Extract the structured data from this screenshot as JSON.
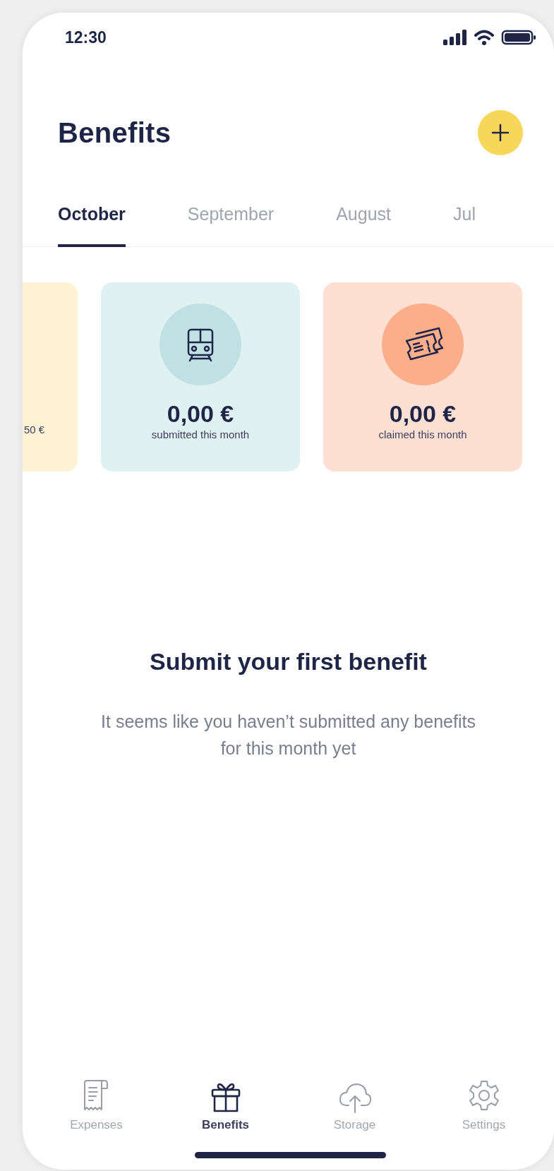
{
  "status_bar": {
    "time": "12:30"
  },
  "header": {
    "title": "Benefits"
  },
  "tabs": [
    {
      "label": "October",
      "selected": true
    },
    {
      "label": "September",
      "selected": false
    },
    {
      "label": "August",
      "selected": false
    },
    {
      "label": "Jul",
      "selected": false
    }
  ],
  "cards": [
    {
      "kind": "cut",
      "color": "#fdf3d4",
      "caption": "50 €"
    },
    {
      "kind": "train",
      "color": "#e0f1f2",
      "amount": "0,00 €",
      "caption": "submitted this month"
    },
    {
      "kind": "ticket",
      "color": "#fde0d2",
      "amount": "0,00 €",
      "caption": "claimed this month"
    }
  ],
  "empty_state": {
    "title": "Submit your first benefit",
    "message": "It seems like you haven’t submitted any benefits for this month yet"
  },
  "nav": [
    {
      "kind": "receipt",
      "label": "Expenses",
      "selected": false
    },
    {
      "kind": "gift",
      "label": "Benefits",
      "selected": true
    },
    {
      "kind": "cloud",
      "label": "Storage",
      "selected": false
    },
    {
      "kind": "gear",
      "label": "Settings",
      "selected": false
    }
  ]
}
